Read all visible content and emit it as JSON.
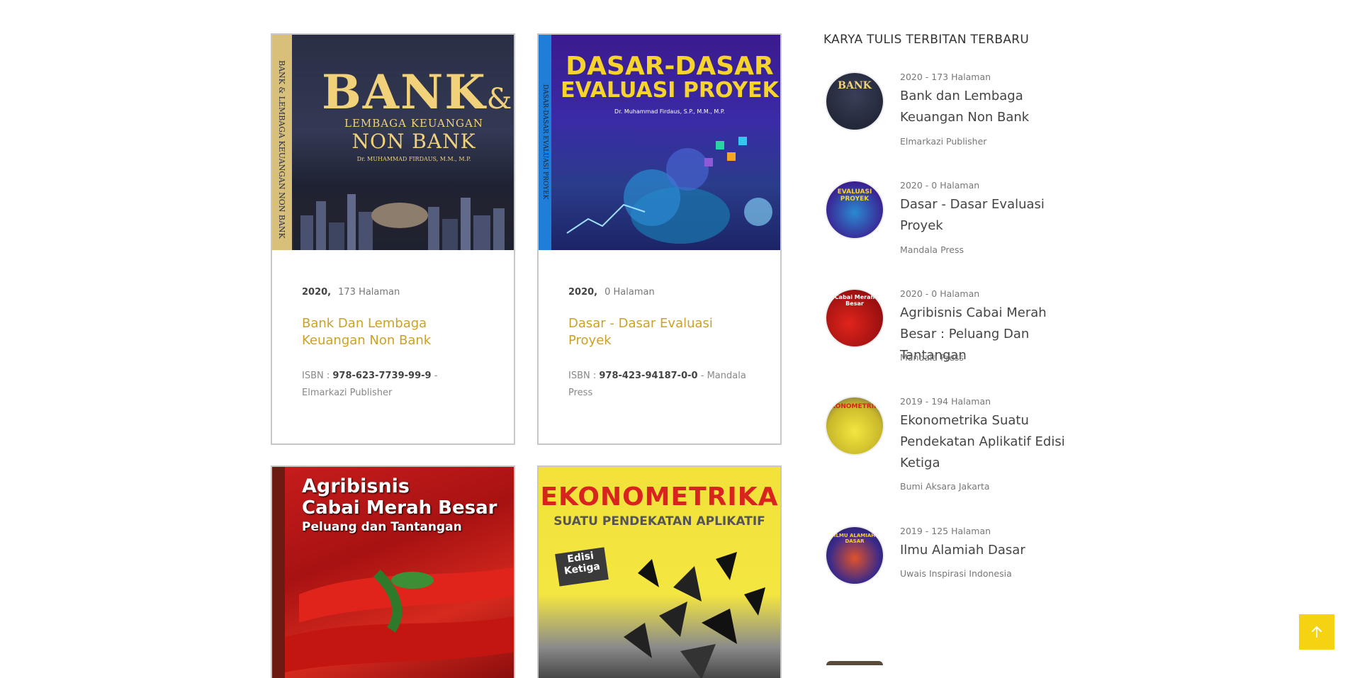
{
  "books": [
    {
      "year": "2020,",
      "pages": "173 Halaman",
      "title": "Bank Dan Lembaga Keuangan Non Bank",
      "isbn_label": "ISBN :",
      "isbn": "978-623-7739-99-9",
      "sep": "-",
      "publisher": "Elmarkazi Publisher",
      "cover": {
        "big": "BANK",
        "amp": "&",
        "line2": "LEMBAGA KEUANGAN",
        "line3": "NON BANK",
        "author": "Dr. MUHAMMAD FIRDAUS, M.M., M.P.",
        "spine": "BANK & LEMBAGA KEUANGAN NON BANK"
      }
    },
    {
      "year": "2020,",
      "pages": "0 Halaman",
      "title": "Dasar - Dasar Evaluasi Proyek",
      "isbn_label": "ISBN :",
      "isbn": "978-423-94187-0-0",
      "sep": "-",
      "publisher": "Mandala Press",
      "cover": {
        "line1": "DASAR-DASAR",
        "line2": "EVALUASI PROYEK",
        "author": "Dr. Muhammad Firdaus, S.P., M.M., M.P.",
        "spine": "DASAR-DASAR EVALUASI PROYEK"
      }
    },
    {
      "cover": {
        "line1": "Agribisnis",
        "line2": "Cabai Merah Besar",
        "line3": "Peluang dan Tantangan"
      }
    },
    {
      "cover": {
        "line1": "EKONOMETRIKA",
        "line2": "SUATU PENDEKATAN APLIKATIF",
        "badge1": "Edisi",
        "badge2": "Ketiga"
      }
    }
  ],
  "sidebar": {
    "heading": "KARYA TULIS TERBITAN TERBARU",
    "items": [
      {
        "meta": "2020 - 173 Halaman",
        "title": "Bank dan Lembaga Keuangan Non Bank",
        "publisher": "Elmarkazi Publisher",
        "thumb_text": "BANK"
      },
      {
        "meta": "2020 - 0 Halaman",
        "title": "Dasar - Dasar Evaluasi Proyek",
        "publisher": "Mandala Press",
        "thumb_text": "EVALUASI PROYEK"
      },
      {
        "meta": "2020 - 0 Halaman",
        "title": "Agribisnis Cabai Merah Besar : Peluang Dan Tantangan",
        "publisher": "Mandala Press",
        "thumb_text": "Cabai Merah Besar"
      },
      {
        "meta": "2019 - 194 Halaman",
        "title": "Ekonometrika Suatu Pendekatan Aplikatif Edisi Ketiga",
        "publisher": "Bumi Aksara Jakarta",
        "thumb_text": "EKONOMETRIKA"
      },
      {
        "meta": "2019 - 125 Halaman",
        "title": "Ilmu Alamiah Dasar",
        "publisher": "Uwais Inspirasi Indonesia",
        "thumb_text": "ILMU ALAMIAH DASAR"
      }
    ]
  },
  "colors": {
    "accent": "#c9a227",
    "button": "#f5d312"
  },
  "icons": {
    "back_to_top": "arrow-up-icon"
  }
}
